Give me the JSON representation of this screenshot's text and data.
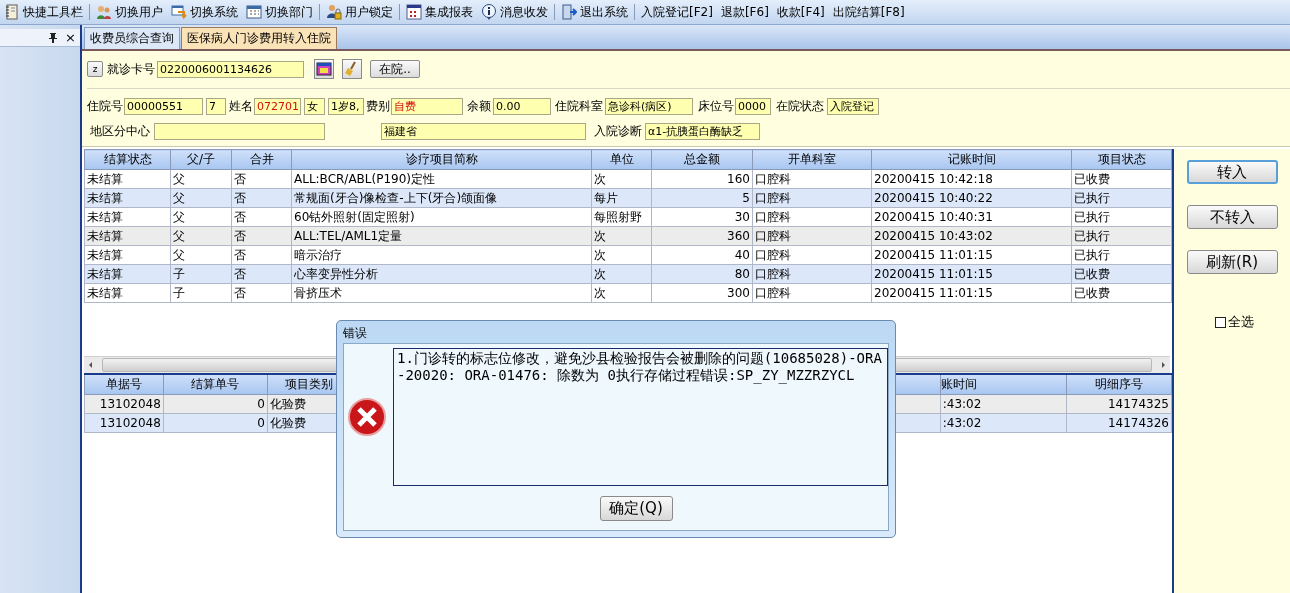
{
  "toolbar": {
    "groups": [
      [
        {
          "kind": "icon",
          "label": "快捷工具栏"
        }
      ],
      [
        {
          "kind": "icon",
          "label": "切换用户"
        },
        {
          "kind": "icon",
          "label": "切换系统"
        },
        {
          "kind": "icon",
          "label": "切换部门"
        }
      ],
      [
        {
          "kind": "icon",
          "label": "用户锁定"
        }
      ],
      [
        {
          "kind": "icon",
          "label": "集成报表"
        },
        {
          "kind": "icon",
          "label": "消息收发"
        }
      ],
      [
        {
          "kind": "icon",
          "label": "退出系统"
        }
      ],
      [
        {
          "kind": "text",
          "label": "入院登记[F2]"
        },
        {
          "kind": "text",
          "label": "退款[F6]"
        },
        {
          "kind": "text",
          "label": "收款[F4]"
        },
        {
          "kind": "text",
          "label": "出院结算[F8]"
        }
      ]
    ]
  },
  "side_panel": {
    "close": "×"
  },
  "tabs": [
    {
      "label": "收费员综合查询",
      "selected": false
    },
    {
      "label": "医保病人门诊费用转入住院",
      "selected": true
    }
  ],
  "form": {
    "card_lookup": [
      {
        "kind": "button",
        "label": "z"
      },
      {
        "kind": "label",
        "text": "就诊卡号"
      },
      {
        "kind": "field",
        "value": "0220006001134626",
        "highlight": false
      },
      {
        "kind": "icon-button"
      },
      {
        "kind": "icon-button"
      },
      {
        "kind": "button",
        "label": "在院.."
      }
    ],
    "patient_info": [
      {
        "kind": "label",
        "text": "住院号"
      },
      {
        "kind": "field",
        "value": "00000551",
        "highlight": false
      },
      {
        "kind": "field",
        "value": "7",
        "highlight": false
      },
      {
        "kind": "label",
        "text": "姓名"
      },
      {
        "kind": "field",
        "value": "072701",
        "highlight": true
      },
      {
        "kind": "field",
        "value": "女",
        "highlight": false
      },
      {
        "kind": "field",
        "value": "1岁8,",
        "highlight": false
      },
      {
        "kind": "label",
        "text": "费别"
      },
      {
        "kind": "field",
        "value": "自费",
        "highlight": true
      },
      {
        "kind": "label",
        "text": "余额"
      },
      {
        "kind": "field",
        "value": "0.00",
        "highlight": false
      },
      {
        "kind": "label",
        "text": "住院科室"
      },
      {
        "kind": "field",
        "value": "急诊科(病区)",
        "highlight": false
      },
      {
        "kind": "label",
        "text": "床位号"
      },
      {
        "kind": "field",
        "value": "0000",
        "highlight": false
      },
      {
        "kind": "label",
        "text": "在院状态"
      },
      {
        "kind": "field",
        "value": "入院登记",
        "highlight": false
      }
    ],
    "region_info": [
      {
        "kind": "label",
        "text": "地区分中心"
      },
      {
        "kind": "field"
      },
      {
        "kind": "field",
        "value": "福建省",
        "highlight": false
      },
      {
        "kind": "label",
        "text": "入院诊断"
      },
      {
        "kind": "field",
        "value": "α1-抗胰蛋白酶缺乏",
        "highlight": false
      }
    ]
  },
  "items_table": {
    "columns": [
      "结算状态",
      "父/子",
      "合并",
      "诊疗项目简称",
      "单位",
      "总金额",
      "开单科室",
      "记账时间",
      "项目状态"
    ],
    "rows": [
      {
        "selected": false,
        "cells": [
          "未结算",
          "父",
          "否",
          "ALL:BCR/ABL(P190)定性",
          "次",
          "160",
          "口腔科",
          "20200415 10:42:18",
          "已收费"
        ]
      },
      {
        "selected": false,
        "cells": [
          "未结算",
          "父",
          "否",
          "常规面(牙合)像检查-上下(牙合)颌面像",
          "每片",
          "5",
          "口腔科",
          "20200415 10:40:22",
          "已执行"
        ]
      },
      {
        "selected": false,
        "cells": [
          "未结算",
          "父",
          "否",
          "60钴外照射(固定照射)",
          "每照射野",
          "30",
          "口腔科",
          "20200415 10:40:31",
          "已执行"
        ]
      },
      {
        "selected": true,
        "cells": [
          "未结算",
          "父",
          "否",
          "ALL:TEL/AML1定量",
          "次",
          "360",
          "口腔科",
          "20200415 10:43:02",
          "已执行"
        ]
      },
      {
        "selected": false,
        "cells": [
          "未结算",
          "父",
          "否",
          "暗示治疗",
          "次",
          "40",
          "口腔科",
          "20200415 11:01:15",
          "已执行"
        ]
      },
      {
        "selected": false,
        "cells": [
          "未结算",
          "子",
          "否",
          "心率变异性分析",
          "次",
          "80",
          "口腔科",
          "20200415 11:01:15",
          "已收费"
        ]
      },
      {
        "selected": false,
        "cells": [
          "未结算",
          "子",
          "否",
          "骨挤压术",
          "次",
          "300",
          "口腔科",
          "20200415 11:01:15",
          "已收费"
        ]
      }
    ]
  },
  "detail_table": {
    "columns": [
      "单据号",
      "结算单号",
      "项目类别",
      "账时间",
      "明细序号"
    ],
    "rows": [
      {
        "selected": true,
        "cells": [
          "13102048",
          "0",
          "化验费",
          ":43:02",
          "14174325"
        ]
      },
      {
        "selected": false,
        "cells": [
          "13102048",
          "0",
          "化验费",
          ":43:02",
          "14174326"
        ]
      }
    ]
  },
  "actions": {
    "buttons": [
      {
        "label": "转入",
        "focused": true
      },
      {
        "label": "不转入",
        "focused": false
      },
      {
        "label": "刷新(R)",
        "focused": false
      }
    ],
    "select_all": {
      "label": "全选",
      "checked": false
    }
  },
  "dialog": {
    "title": "错误",
    "message": "1.门诊转的标志位修改，避免沙县检验报告会被删除的问题(10685028)-ORA-20020: ORA-01476: 除数为 0执行存储过程错误:SP_ZY_MZZRZYCL",
    "button": "确定(Q)"
  }
}
